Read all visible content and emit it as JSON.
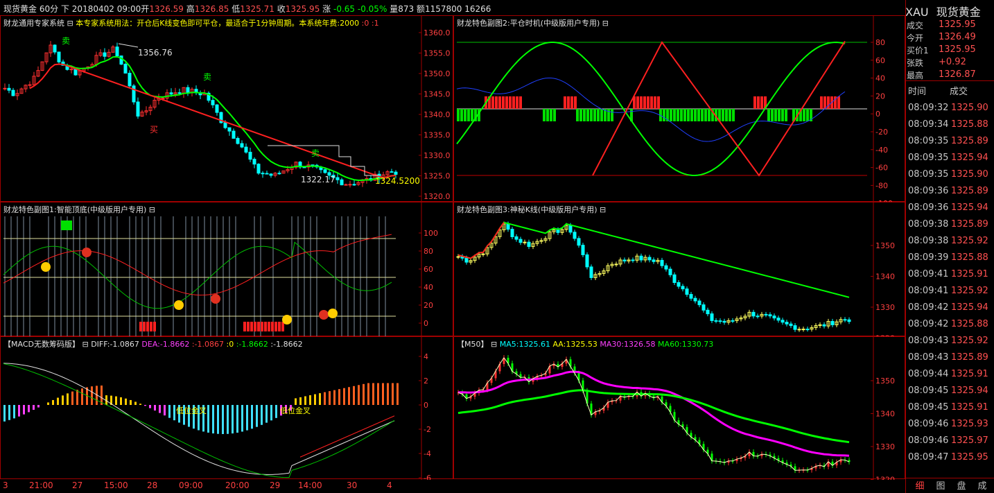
{
  "header": {
    "symbol": "现货黄金",
    "period": "60分",
    "mode": "下",
    "datetime": "20180402 09:00",
    "open_label": "开",
    "open": "1326.59",
    "high_label": "高",
    "high": "1326.85",
    "low_label": "低",
    "low": "1325.71",
    "close_label": "收",
    "close": "1325.95",
    "change_label": "涨",
    "change": "-0.65",
    "change_pct": "-0.05%",
    "volume_label": "量",
    "volume": "873",
    "amount_label": "额",
    "amount": "1157800",
    "extra": "16266"
  },
  "main_chart": {
    "title": "财龙通用专家系统",
    "desc": "本专家系统用法：开仓后K线变色即可平仓，最适合于1分钟周期。本系统年费:2000",
    "p1": ":0",
    "p2": ":1",
    "ann_high": "1356.76",
    "ann_low": "1322.17",
    "ann_last": "1324.5200",
    "sell1": "卖",
    "sell2": "卖",
    "sell3": "卖",
    "buy1": "买",
    "ticks": [
      "1360.0",
      "1355.0",
      "1350.0",
      "1345.0",
      "1340.0",
      "1335.0",
      "1330.0",
      "1325.0",
      "1320.0"
    ]
  },
  "sub2": {
    "title": "财龙特色副图2:平仓时机(中级版用户专用)",
    "ticks": [
      "80",
      "60",
      "40",
      "20",
      "0",
      "-20",
      "-40",
      "-60",
      "-80",
      "-100"
    ]
  },
  "sub1": {
    "title": "财龙特色副图1:智能顶底(中级版用户专用)",
    "ticks": [
      "100",
      "80",
      "60",
      "40",
      "20",
      "0"
    ]
  },
  "sub3": {
    "title": "财龙特色副图3:神秘K线(中级版用户专用)",
    "ticks": [
      "1350",
      "1340",
      "1330",
      "1320"
    ]
  },
  "macd": {
    "title": "【MACD无数筹码版】",
    "diff_label": "DIFF:",
    "diff": "-1.0867",
    "dea_label": "DEA:",
    "dea": "-1.8662",
    "v3": ":-1.0867",
    "v4": ":0",
    "v5": ":-1.8662",
    "v6": ":-1.8662",
    "cross1": "低位金叉",
    "cross2": "低位金叉",
    "ticks": [
      "4",
      "2",
      "0",
      "-2",
      "-4",
      "-6"
    ]
  },
  "ma": {
    "title": "【M50】",
    "ma5_label": "MA5:",
    "ma5": "1325.61",
    "aa_label": "AA:",
    "aa": "1325.53",
    "ma30_label": "MA30:",
    "ma30": "1326.58",
    "ma60_label": "MA60:",
    "ma60": "1330.73",
    "ticks": [
      "1350",
      "1340",
      "1330",
      "1320"
    ]
  },
  "xaxis": [
    "3",
    "21:00",
    "27",
    "15:00",
    "28",
    "09:00",
    "20:00",
    "29",
    "14:00",
    "30",
    "4"
  ],
  "quote": {
    "code": "XAU",
    "name": "现货黄金",
    "rows": [
      {
        "label": "成交",
        "value": "1325.95"
      },
      {
        "label": "今开",
        "value": "1326.49"
      },
      {
        "label": "买价1",
        "value": "1325.95"
      },
      {
        "label": "张跌",
        "value": "+0.92"
      },
      {
        "label": "最高",
        "value": "1326.87"
      }
    ],
    "time_header": "时间",
    "price_header": "成交",
    "ticks": [
      {
        "t": "08:09:32",
        "p": "1325.90"
      },
      {
        "t": "08:09:34",
        "p": "1325.88"
      },
      {
        "t": "08:09:35",
        "p": "1325.89"
      },
      {
        "t": "08:09:35",
        "p": "1325.94"
      },
      {
        "t": "08:09:35",
        "p": "1325.90"
      },
      {
        "t": "08:09:36",
        "p": "1325.89"
      },
      {
        "t": "08:09:36",
        "p": "1325.94"
      },
      {
        "t": "08:09:38",
        "p": "1325.89"
      },
      {
        "t": "08:09:38",
        "p": "1325.92"
      },
      {
        "t": "08:09:39",
        "p": "1325.88"
      },
      {
        "t": "08:09:41",
        "p": "1325.91"
      },
      {
        "t": "08:09:41",
        "p": "1325.92"
      },
      {
        "t": "08:09:42",
        "p": "1325.94"
      },
      {
        "t": "08:09:42",
        "p": "1325.88"
      },
      {
        "t": "08:09:43",
        "p": "1325.92"
      },
      {
        "t": "08:09:43",
        "p": "1325.89"
      },
      {
        "t": "08:09:44",
        "p": "1325.91"
      },
      {
        "t": "08:09:45",
        "p": "1325.94"
      },
      {
        "t": "08:09:45",
        "p": "1325.91"
      },
      {
        "t": "08:09:46",
        "p": "1325.93"
      },
      {
        "t": "08:09:46",
        "p": "1325.97"
      },
      {
        "t": "08:09:47",
        "p": "1325.95"
      }
    ],
    "tabs": [
      "细",
      "图",
      "盘",
      "成"
    ]
  },
  "colors": {
    "up": "#ff3030",
    "down": "#00ffff",
    "grid": "#a00000",
    "green": "#00ff00",
    "yellow": "#ffff00",
    "magenta": "#ff00ff",
    "blue": "#2040ff"
  }
}
